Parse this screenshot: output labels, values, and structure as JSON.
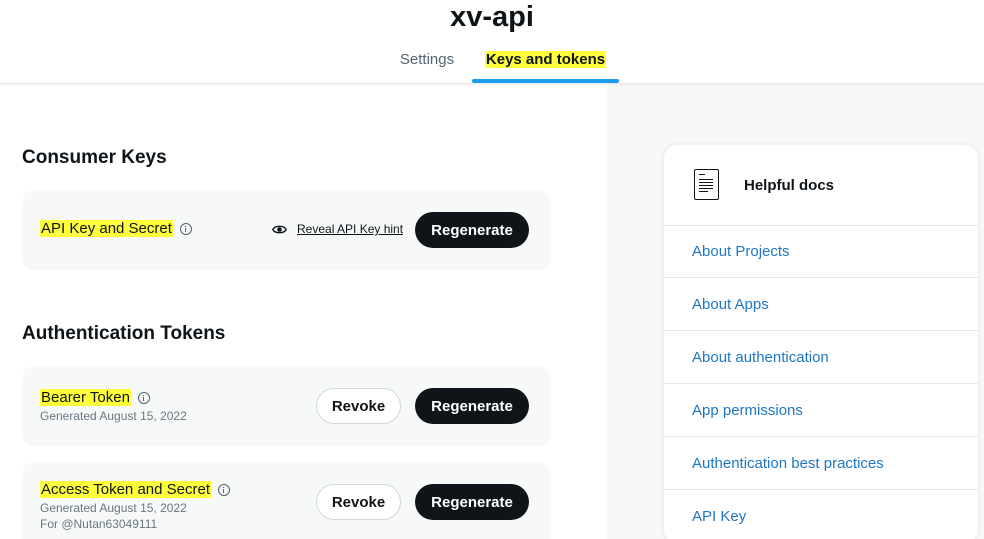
{
  "header": {
    "app_title": "xv-api",
    "tabs": [
      {
        "label": "Settings",
        "active": false
      },
      {
        "label": "Keys and tokens",
        "active": true
      }
    ]
  },
  "consumer_keys": {
    "section_title": "Consumer Keys",
    "api_key": {
      "label": "API Key and Secret",
      "reveal_label": "Reveal API Key hint",
      "regenerate_label": "Regenerate"
    }
  },
  "auth_tokens": {
    "section_title": "Authentication Tokens",
    "bearer": {
      "label": "Bearer Token",
      "generated": "Generated August 15, 2022",
      "revoke_label": "Revoke",
      "regenerate_label": "Regenerate"
    },
    "access": {
      "label": "Access Token and Secret",
      "generated": "Generated August 15, 2022",
      "for_user": "For @Nutan63049111",
      "revoke_label": "Revoke",
      "regenerate_label": "Regenerate"
    }
  },
  "helpful_docs": {
    "title": "Helpful docs",
    "links": [
      "About Projects",
      "About Apps",
      "About authentication",
      "App permissions",
      "Authentication best practices",
      "API Key"
    ]
  },
  "icons": {
    "info": "info-icon",
    "eye": "eye-icon",
    "document": "document-icon"
  },
  "colors": {
    "accent": "#1d9bf0",
    "link": "#1d77c2",
    "highlight": "#ffff3b",
    "button_dark": "#0f1419"
  }
}
